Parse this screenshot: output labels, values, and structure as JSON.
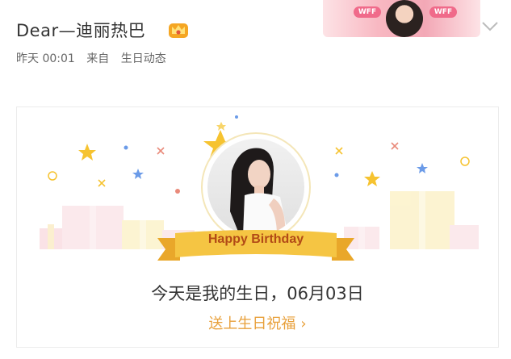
{
  "header": {
    "username": "Dear—迪丽热巴",
    "vip_icon": "crown-icon",
    "time": "昨天 00:01",
    "source_prefix": "来自",
    "source": "生日动态",
    "fan_banner_tag": "WFF"
  },
  "card": {
    "ribbon_text": "Happy Birthday",
    "message": "今天是我的生日，06月03日",
    "cta": "送上生日祝福",
    "cta_arrow": "›"
  },
  "colors": {
    "cta": "#e8a03b",
    "ribbon": "#f5c543",
    "ribbon_text": "#b24a16"
  }
}
